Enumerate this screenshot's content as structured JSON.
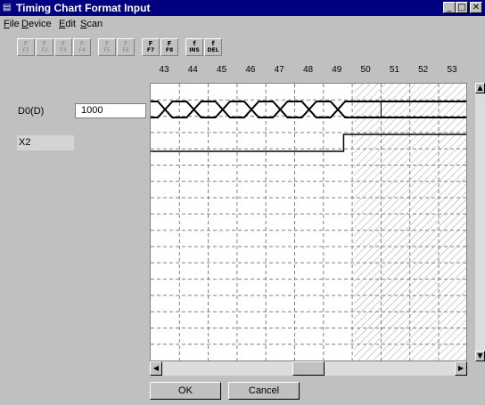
{
  "window": {
    "title": "Timing Chart Format Input",
    "icon": "app-icon",
    "controls": [
      "minimize-icon",
      "maximize-icon",
      "close-icon"
    ]
  },
  "menu": [
    {
      "label": "File",
      "key": "F",
      "rest": "ile"
    },
    {
      "label": "Device",
      "key": "D",
      "rest": "evice"
    },
    {
      "label": "Edit",
      "key": "E",
      "rest": "dit"
    },
    {
      "label": "Scan",
      "key": "S",
      "rest": "can"
    }
  ],
  "toolbar": [
    {
      "top": "F",
      "sub": "F1",
      "enabled": false
    },
    {
      "top": "F",
      "sub": "F2",
      "enabled": false
    },
    {
      "top": "F",
      "sub": "F3",
      "enabled": false
    },
    {
      "top": "F",
      "sub": "F4",
      "enabled": false
    },
    {
      "top": "F",
      "sub": "F5",
      "enabled": false
    },
    {
      "top": "F",
      "sub": "F6",
      "enabled": false
    },
    {
      "top": "F",
      "sub": "F7",
      "enabled": true
    },
    {
      "top": "F",
      "sub": "F8",
      "enabled": true
    },
    {
      "top": "f",
      "sub": "INS",
      "enabled": true
    },
    {
      "top": "f",
      "sub": "DEL",
      "enabled": true
    }
  ],
  "ruler": [
    "43",
    "44",
    "45",
    "46",
    "47",
    "48",
    "49",
    "50",
    "51",
    "52",
    "53"
  ],
  "devices": [
    {
      "name": "D0(D)",
      "value": "1000"
    },
    {
      "name": "X2",
      "value": ""
    }
  ],
  "buttons": {
    "ok": "OK",
    "cancel": "Cancel"
  },
  "scrollbar": {
    "horizontal_position": 0.5,
    "vertical_position": 0.0
  },
  "colors": {
    "titlebar": "#000080",
    "face": "#c0c0c0",
    "chart_bg": "#ffffff"
  }
}
